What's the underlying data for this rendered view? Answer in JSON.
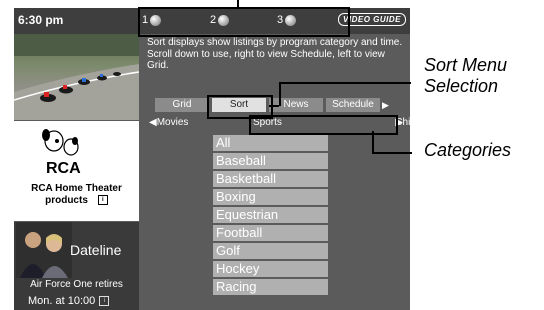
{
  "topbar": {
    "time": "6:30 pm",
    "slots": [
      "1",
      "2",
      "3"
    ],
    "logo": "VIDEO GUIDE"
  },
  "ad": {
    "brand": "RCA",
    "text_line1": "RCA Home Theater",
    "text_line2": "products"
  },
  "promo": {
    "title": "Dateline",
    "line1": "Air Force One retires",
    "line2": "Mon. at 10:00"
  },
  "description": "Sort displays show listings by program category and time. Scroll down to use, right to view Schedule, left to view Grid.",
  "tabs": [
    "Grid",
    "Sort",
    "News",
    "Schedule"
  ],
  "categories": {
    "left": "Movies",
    "center": "Sports",
    "right": "Children"
  },
  "list": [
    "All",
    "Baseball",
    "Basketball",
    "Boxing",
    "Equestrian",
    "Football",
    "Golf",
    "Hockey",
    "Racing"
  ],
  "callouts": {
    "sort_menu_line1": "Sort Menu",
    "sort_menu_line2": "Selection",
    "categories": "Categories"
  }
}
